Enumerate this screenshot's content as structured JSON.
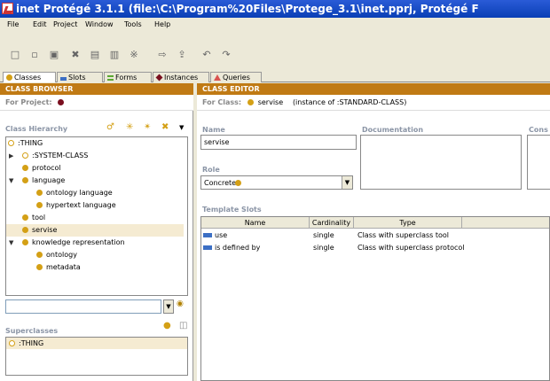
{
  "window": {
    "title": "inet  Protégé 3.1.1     (file:\\C:\\Program%20Files\\Protege_3.1\\inet.pprj, Protégé F"
  },
  "menu": [
    "File",
    "Edit",
    "Project",
    "Window",
    "Tools",
    "Help"
  ],
  "toolbar_icons": [
    "new-file-icon",
    "open-folder-icon",
    "save-icon",
    "cut-icon",
    "copy-icon",
    "paste-icon",
    "tools-icon",
    "export-icon",
    "undo-icon",
    "redo-icon"
  ],
  "tabs": [
    {
      "label": "Classes",
      "color": "#d4a016",
      "active": true
    },
    {
      "label": "Slots",
      "color": "#3c6fc4",
      "active": false
    },
    {
      "label": "Forms",
      "color": "#5ca832",
      "active": false
    },
    {
      "label": "Instances",
      "color": "#7a0f1f",
      "active": false
    },
    {
      "label": "Queries",
      "color": "#d9534f",
      "active": false
    }
  ],
  "browser": {
    "header": "CLASS BROWSER",
    "project_label": "For Project:",
    "hierarchy_label": "Class Hierarchy",
    "tree": [
      {
        "label": ":THING",
        "depth": 0,
        "toggle": "",
        "hollow": true
      },
      {
        "label": ":SYSTEM-CLASS",
        "depth": 1,
        "toggle": "▶",
        "hollow": true
      },
      {
        "label": "protocol",
        "depth": 1,
        "toggle": ""
      },
      {
        "label": "language",
        "depth": 1,
        "toggle": "▼"
      },
      {
        "label": "ontology language",
        "depth": 2,
        "toggle": ""
      },
      {
        "label": "hypertext language",
        "depth": 2,
        "toggle": ""
      },
      {
        "label": "tool",
        "depth": 1,
        "toggle": ""
      },
      {
        "label": "servise",
        "depth": 1,
        "toggle": "",
        "selected": true
      },
      {
        "label": "knowledge representation",
        "depth": 1,
        "toggle": "▼"
      },
      {
        "label": "ontology",
        "depth": 2,
        "toggle": ""
      },
      {
        "label": "metadata",
        "depth": 2,
        "toggle": ""
      }
    ],
    "superclasses_label": "Superclasses",
    "superclasses": [
      ":THING"
    ]
  },
  "editor": {
    "header": "CLASS EDITOR",
    "for_class_label": "For Class:",
    "class_name": "servise",
    "instance_of": "(instance of :STANDARD-CLASS)",
    "name_label": "Name",
    "name_value": "servise",
    "documentation_label": "Documentation",
    "constraints_label": "Cons",
    "role_label": "Role",
    "role_value": "Concrete",
    "template_slots_label": "Template Slots",
    "columns": [
      "Name",
      "Cardinality",
      "Type"
    ],
    "slots": [
      {
        "name": "use",
        "cardinality": "single",
        "type": "Class with superclass tool"
      },
      {
        "name": "is defined by",
        "cardinality": "single",
        "type": "Class with superclass protocol"
      }
    ]
  }
}
